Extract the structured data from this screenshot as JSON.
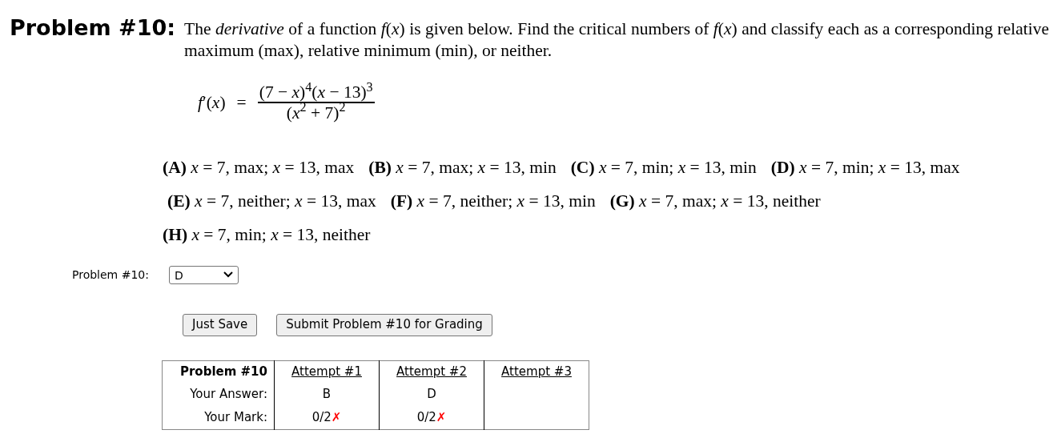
{
  "problem": {
    "title": "Problem #10:",
    "statement": "The *derivative* of a function *f*(*x*) is given below. Find the critical numbers of *f*(*x*) and classify each as a corresponding relative maximum (max), relative minimum (min), or neither.",
    "formula": {
      "lhs": "*f*′(*x*)",
      "relation": "=",
      "numerator": "(7 − *x*)$^{4}$(*x* − 13)$^{3}$",
      "denominator": "(*x*$^{2}$ + 7)$^{2}$"
    },
    "choice_rows": [
      [
        {
          "label": "(A)",
          "text": "*x* = 7, max; *x* = 13, max"
        },
        {
          "label": "(B)",
          "text": "*x* = 7, max; *x* = 13, min"
        },
        {
          "label": "(C)",
          "text": "*x* = 7, min; *x* = 13, min"
        },
        {
          "label": "(D)",
          "text": "*x* = 7, min; *x* = 13, max"
        }
      ],
      [
        {
          "label": "(E)",
          "text": "*x* = 7, neither; *x* = 13, max"
        },
        {
          "label": "(F)",
          "text": "*x* = 7, neither; *x* = 13, min"
        },
        {
          "label": "(G)",
          "text": "*x* = 7, max; *x* = 13, neither"
        }
      ],
      [
        {
          "label": "(H)",
          "text": "*x* = 7, min; *x* = 13, neither"
        }
      ]
    ]
  },
  "answer": {
    "label": "Problem #10:",
    "value": "D"
  },
  "buttons": [
    "Just Save",
    "Submit Problem #10 for Grading"
  ],
  "attempts_table": {
    "header": "Problem #10",
    "attempts": [
      "Attempt #1",
      "Attempt #2",
      "Attempt #3"
    ],
    "rows": [
      {
        "label": "Your Answer:",
        "cells": [
          {
            "text": "B"
          },
          {
            "text": "D"
          },
          null
        ]
      },
      {
        "label": "Your Mark:",
        "cells": [
          {
            "text": "0/2",
            "symbol": "✗",
            "correct": false
          },
          {
            "text": "0/2",
            "symbol": "✗",
            "correct": false
          },
          null
        ]
      }
    ]
  }
}
